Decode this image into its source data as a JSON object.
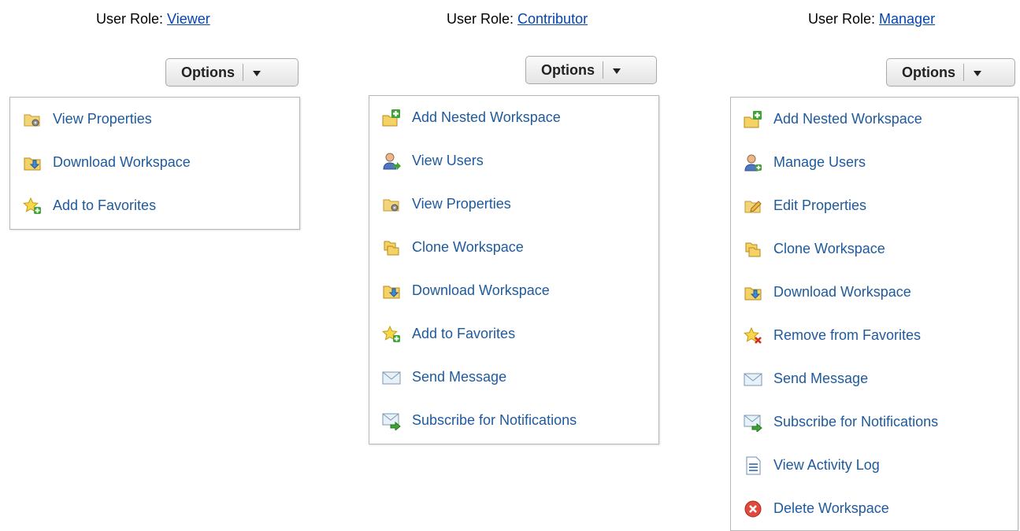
{
  "columns": [
    {
      "role_prefix": "User Role: ",
      "role_name": "Viewer",
      "options_label": "Options",
      "items": [
        {
          "label": "View Properties",
          "icon": "view-properties-icon"
        },
        {
          "label": "Download Workspace",
          "icon": "download-workspace-icon"
        },
        {
          "label": "Add to Favorites",
          "icon": "add-favorites-icon"
        }
      ]
    },
    {
      "role_prefix": "User Role: ",
      "role_name": "Contributor",
      "options_label": "Options",
      "items": [
        {
          "label": "Add Nested Workspace",
          "icon": "add-nested-workspace-icon"
        },
        {
          "label": "View Users",
          "icon": "view-users-icon"
        },
        {
          "label": "View Properties",
          "icon": "view-properties-icon"
        },
        {
          "label": "Clone Workspace",
          "icon": "clone-workspace-icon"
        },
        {
          "label": "Download Workspace",
          "icon": "download-workspace-icon"
        },
        {
          "label": "Add to Favorites",
          "icon": "add-favorites-icon"
        },
        {
          "label": "Send Message",
          "icon": "send-message-icon"
        },
        {
          "label": "Subscribe for Notifications",
          "icon": "subscribe-notifications-icon"
        }
      ]
    },
    {
      "role_prefix": "User Role: ",
      "role_name": "Manager",
      "options_label": "Options",
      "items": [
        {
          "label": "Add Nested Workspace",
          "icon": "add-nested-workspace-icon"
        },
        {
          "label": "Manage Users",
          "icon": "manage-users-icon"
        },
        {
          "label": "Edit Properties",
          "icon": "edit-properties-icon"
        },
        {
          "label": "Clone Workspace",
          "icon": "clone-workspace-icon"
        },
        {
          "label": "Download Workspace",
          "icon": "download-workspace-icon"
        },
        {
          "label": "Remove from Favorites",
          "icon": "remove-favorites-icon"
        },
        {
          "label": "Send Message",
          "icon": "send-message-icon"
        },
        {
          "label": "Subscribe for Notifications",
          "icon": "subscribe-notifications-icon"
        },
        {
          "label": "View Activity Log",
          "icon": "view-activity-log-icon"
        },
        {
          "label": "Delete Workspace",
          "icon": "delete-workspace-icon"
        }
      ]
    }
  ],
  "colors": {
    "link": "#0645ad",
    "menu_text": "#1e5a9c",
    "border": "#b7b7b7"
  }
}
